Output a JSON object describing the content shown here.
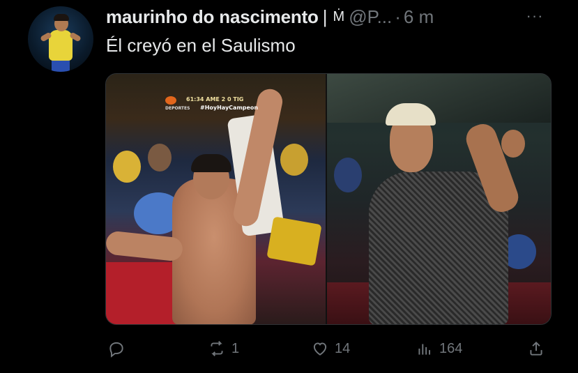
{
  "tweet": {
    "display_name": "maurinho do nascimento",
    "separator": "|",
    "badge": "Ṁ",
    "handle": "@P...",
    "dot": "·",
    "time": "6 m",
    "more_label": "···",
    "text": "Él creyó en el Saulismo"
  },
  "media": {
    "left_photo": {
      "scorebug_time": "61:34",
      "scorebug_teams": "AME 2 0 TIG",
      "scorebug_network": "DEPORTES",
      "scorebug_hashtag": "#HoyHayCampeon"
    }
  },
  "actions": {
    "reply": {
      "icon": "reply-icon",
      "count": ""
    },
    "retweet": {
      "icon": "retweet-icon",
      "count": "1"
    },
    "like": {
      "icon": "heart-icon",
      "count": "14"
    },
    "views": {
      "icon": "views-icon",
      "count": "164"
    },
    "share": {
      "icon": "share-icon",
      "count": ""
    }
  },
  "colors": {
    "background": "#000000",
    "text_primary": "#e7e9ea",
    "text_secondary": "#71767b",
    "border": "#2f3336"
  }
}
